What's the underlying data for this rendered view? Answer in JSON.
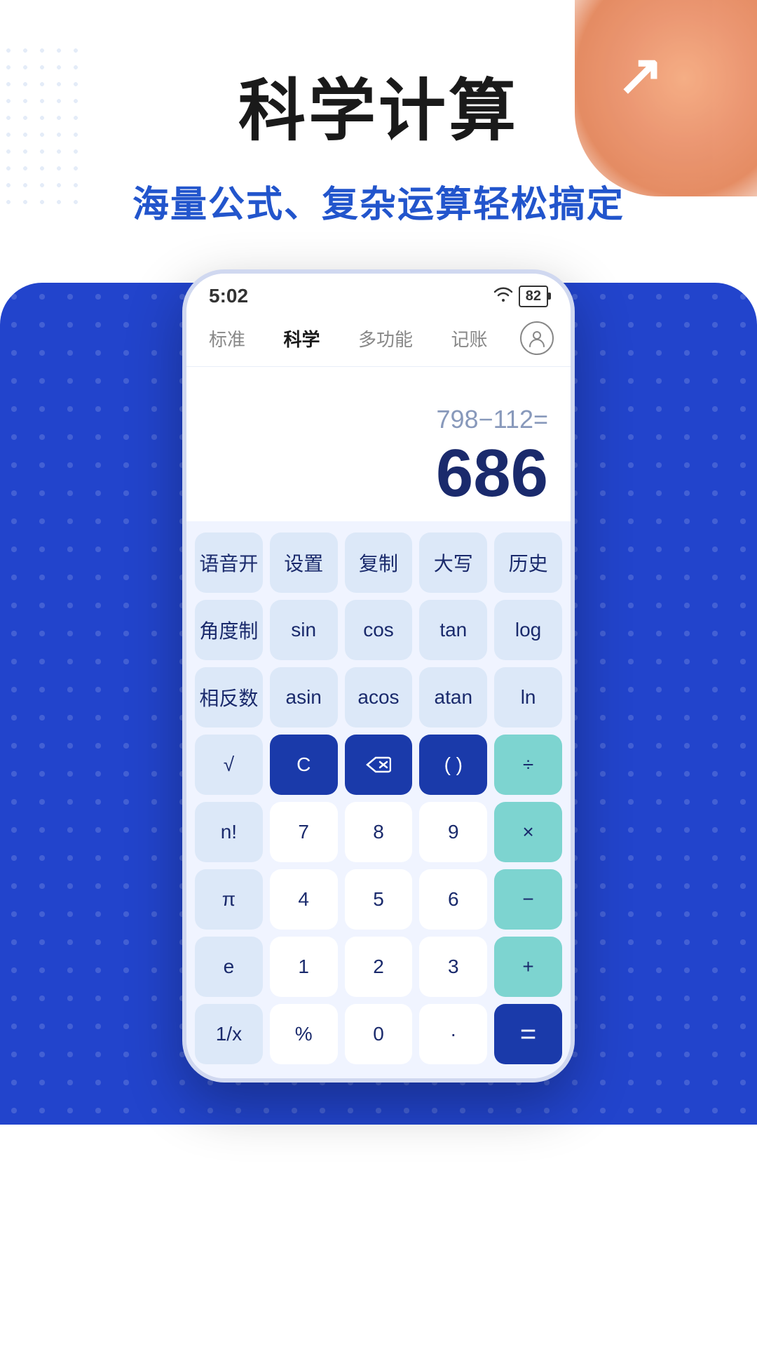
{
  "title": "科学计算",
  "subtitle": "海量公式、复杂运算轻松搞定",
  "status": {
    "time": "5:02",
    "battery": "82"
  },
  "nav": {
    "tabs": [
      {
        "id": "standard",
        "label": "标准",
        "active": false
      },
      {
        "id": "science",
        "label": "科学",
        "active": true
      },
      {
        "id": "multi",
        "label": "多功能",
        "active": false
      },
      {
        "id": "accounting",
        "label": "记账",
        "active": false
      }
    ]
  },
  "display": {
    "expression": "798−112=",
    "result": "686"
  },
  "keyboard": {
    "rows": [
      [
        {
          "label": "语音开",
          "type": "light"
        },
        {
          "label": "设置",
          "type": "light"
        },
        {
          "label": "复制",
          "type": "light"
        },
        {
          "label": "大写",
          "type": "light"
        },
        {
          "label": "历史",
          "type": "light"
        }
      ],
      [
        {
          "label": "角度制",
          "type": "light"
        },
        {
          "label": "sin",
          "type": "light"
        },
        {
          "label": "cos",
          "type": "light"
        },
        {
          "label": "tan",
          "type": "light"
        },
        {
          "label": "log",
          "type": "light"
        }
      ],
      [
        {
          "label": "相反数",
          "type": "light"
        },
        {
          "label": "asin",
          "type": "light"
        },
        {
          "label": "acos",
          "type": "light"
        },
        {
          "label": "atan",
          "type": "light"
        },
        {
          "label": "ln",
          "type": "light"
        }
      ],
      [
        {
          "label": "√",
          "type": "light"
        },
        {
          "label": "C",
          "type": "blue-dark"
        },
        {
          "label": "⌫",
          "type": "blue-dark"
        },
        {
          "label": "( )",
          "type": "blue-dark"
        },
        {
          "label": "÷",
          "type": "teal"
        }
      ],
      [
        {
          "label": "n!",
          "type": "light"
        },
        {
          "label": "7",
          "type": "white"
        },
        {
          "label": "8",
          "type": "white"
        },
        {
          "label": "9",
          "type": "white"
        },
        {
          "label": "×",
          "type": "teal"
        }
      ],
      [
        {
          "label": "π",
          "type": "light"
        },
        {
          "label": "4",
          "type": "white"
        },
        {
          "label": "5",
          "type": "white"
        },
        {
          "label": "6",
          "type": "white"
        },
        {
          "label": "−",
          "type": "teal"
        }
      ],
      [
        {
          "label": "e",
          "type": "light"
        },
        {
          "label": "1",
          "type": "white"
        },
        {
          "label": "2",
          "type": "white"
        },
        {
          "label": "3",
          "type": "white"
        },
        {
          "label": "+",
          "type": "teal"
        }
      ]
    ],
    "bottom_row": [
      {
        "label": "1/x",
        "type": "light"
      },
      {
        "label": "%",
        "type": "white"
      },
      {
        "label": "0",
        "type": "white"
      },
      {
        "label": "·",
        "type": "white"
      },
      {
        "label": "=",
        "type": "equals"
      }
    ]
  },
  "icons": {
    "wifi": "📶",
    "person": "👤"
  }
}
